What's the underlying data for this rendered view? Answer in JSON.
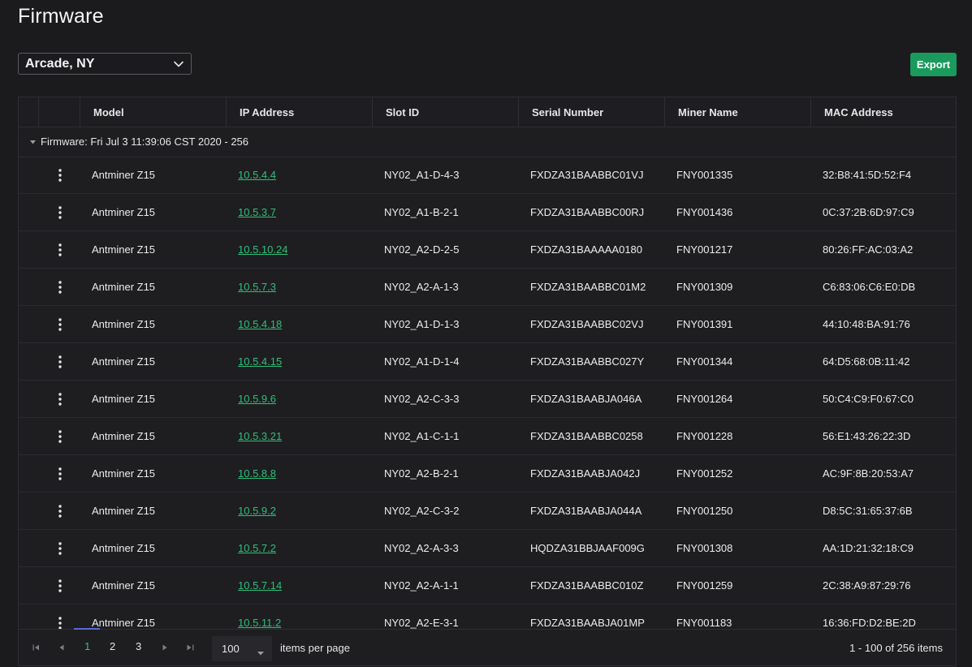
{
  "page": {
    "title": "Firmware"
  },
  "site_select": {
    "value": "Arcade, NY"
  },
  "toolbar": {
    "export_label": "Export"
  },
  "table": {
    "columns": [
      "Model",
      "IP Address",
      "Slot ID",
      "Serial Number",
      "Miner Name",
      "MAC Address"
    ],
    "group_label": "Firmware: Fri Jul 3 11:39:06 CST 2020 - 256",
    "rows": [
      {
        "model": "Antminer Z15",
        "ip": "10.5.4.4",
        "slot": "NY02_A1-D-4-3",
        "serial": "FXDZA31BAABBC01VJ",
        "name": "FNY001335",
        "mac": "32:B8:41:5D:52:F4"
      },
      {
        "model": "Antminer Z15",
        "ip": "10.5.3.7",
        "slot": "NY02_A1-B-2-1",
        "serial": "FXDZA31BAABBC00RJ",
        "name": "FNY001436",
        "mac": "0C:37:2B:6D:97:C9"
      },
      {
        "model": "Antminer Z15",
        "ip": "10.5.10.24",
        "slot": "NY02_A2-D-2-5",
        "serial": "FXDZA31BAAAAA0180",
        "name": "FNY001217",
        "mac": "80:26:FF:AC:03:A2"
      },
      {
        "model": "Antminer Z15",
        "ip": "10.5.7.3",
        "slot": "NY02_A2-A-1-3",
        "serial": "FXDZA31BAABBC01M2",
        "name": "FNY001309",
        "mac": "C6:83:06:C6:E0:DB"
      },
      {
        "model": "Antminer Z15",
        "ip": "10.5.4.18",
        "slot": "NY02_A1-D-1-3",
        "serial": "FXDZA31BAABBC02VJ",
        "name": "FNY001391",
        "mac": "44:10:48:BA:91:76"
      },
      {
        "model": "Antminer Z15",
        "ip": "10.5.4.15",
        "slot": "NY02_A1-D-1-4",
        "serial": "FXDZA31BAABBC027Y",
        "name": "FNY001344",
        "mac": "64:D5:68:0B:11:42"
      },
      {
        "model": "Antminer Z15",
        "ip": "10.5.9.6",
        "slot": "NY02_A2-C-3-3",
        "serial": "FXDZA31BAABJA046A",
        "name": "FNY001264",
        "mac": "50:C4:C9:F0:67:C0"
      },
      {
        "model": "Antminer Z15",
        "ip": "10.5.3.21",
        "slot": "NY02_A1-C-1-1",
        "serial": "FXDZA31BAABBC0258",
        "name": "FNY001228",
        "mac": "56:E1:43:26:22:3D"
      },
      {
        "model": "Antminer Z15",
        "ip": "10.5.8.8",
        "slot": "NY02_A2-B-2-1",
        "serial": "FXDZA31BAABJA042J",
        "name": "FNY001252",
        "mac": "AC:9F:8B:20:53:A7"
      },
      {
        "model": "Antminer Z15",
        "ip": "10.5.9.2",
        "slot": "NY02_A2-C-3-2",
        "serial": "FXDZA31BAABJA044A",
        "name": "FNY001250",
        "mac": "D8:5C:31:65:37:6B"
      },
      {
        "model": "Antminer Z15",
        "ip": "10.5.7.2",
        "slot": "NY02_A2-A-3-3",
        "serial": "HQDZA31BBJAAF009G",
        "name": "FNY001308",
        "mac": "AA:1D:21:32:18:C9"
      },
      {
        "model": "Antminer Z15",
        "ip": "10.5.7.14",
        "slot": "NY02_A2-A-1-1",
        "serial": "FXDZA31BAABBC010Z",
        "name": "FNY001259",
        "mac": "2C:38:A9:87:29:76"
      },
      {
        "model": "Antminer Z15",
        "ip": "10.5.11.2",
        "slot": "NY02_A2-E-3-1",
        "serial": "FXDZA31BAABJA01MP",
        "name": "FNY001183",
        "mac": "16:36:FD:D2:BE:2D"
      }
    ]
  },
  "pager": {
    "pages": [
      "1",
      "2",
      "3"
    ],
    "current_page": "1",
    "page_size": "100",
    "items_per_page_label": "items per page",
    "range_info": "1 - 100 of 256 items"
  },
  "icons": {
    "select_chevron": "chevron-down-icon",
    "group_caret": "caret-down-icon",
    "row_menu": "kebab-menu-icon",
    "first_page": "first-page-icon",
    "prev_page": "prev-page-icon",
    "next_page": "next-page-icon",
    "last_page": "last-page-icon"
  },
  "colors": {
    "background": "#1b1b1e",
    "accent_green": "#1a9a5c",
    "link_green": "#2fbf79",
    "active_page_underline": "#5a6ad6"
  }
}
